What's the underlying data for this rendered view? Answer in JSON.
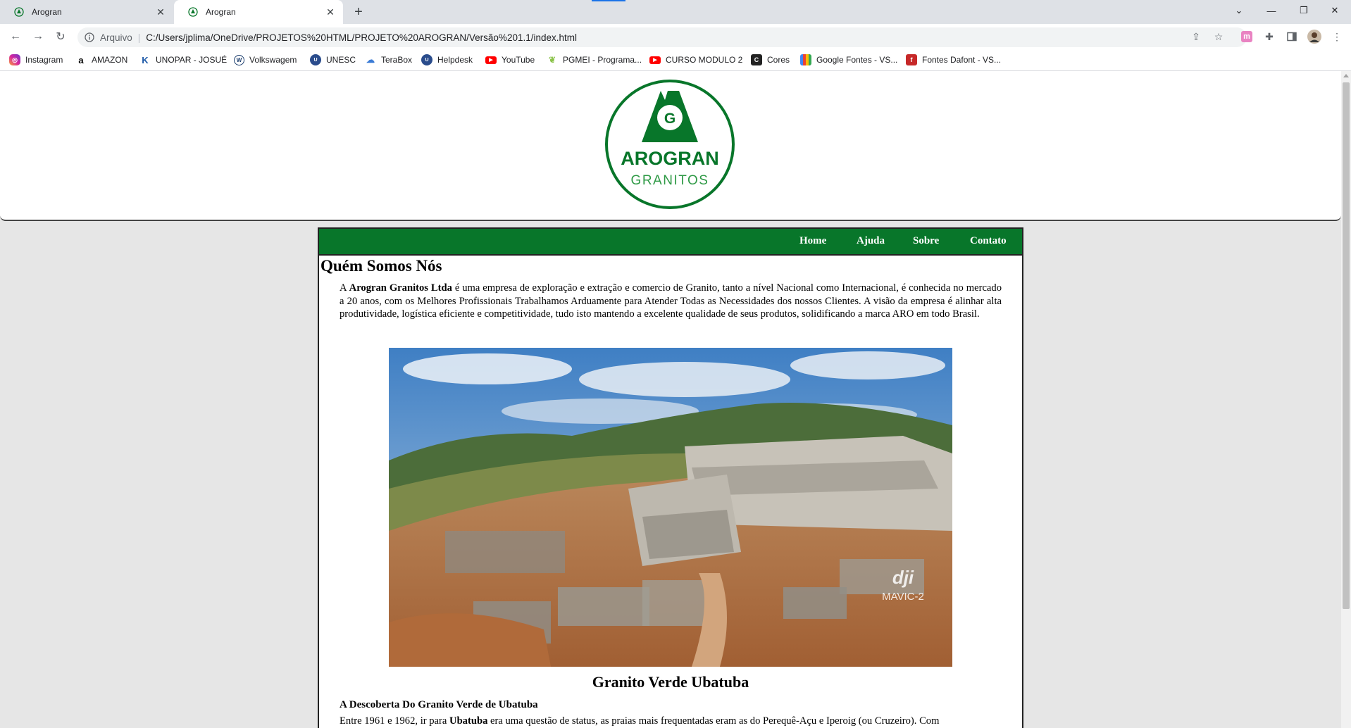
{
  "browser": {
    "tabs": [
      {
        "title": "Arogran",
        "active": false
      },
      {
        "title": "Arogran",
        "active": true
      }
    ],
    "address": {
      "scheme_label": "Arquivo",
      "url": "C:/Users/jplima/OneDrive/PROJETOS%20HTML/PROJETO%20AROGRAN/Versão%201.1/index.html"
    },
    "bookmarks": [
      {
        "label": "Instagram",
        "icon": "instagram-icon",
        "color": "#d6249f"
      },
      {
        "label": "AMAZON",
        "icon": "amazon-icon",
        "color": "#000000"
      },
      {
        "label": "UNOPAR - JOSUÉ",
        "icon": "unopar-icon",
        "color": "#1e5aa8"
      },
      {
        "label": "Volkswagem",
        "icon": "volkswagen-icon",
        "color": "#1b3d6d"
      },
      {
        "label": "UNESC",
        "icon": "unesc-icon",
        "color": "#2a4c8c"
      },
      {
        "label": "TeraBox",
        "icon": "terabox-icon",
        "color": "#3a7bd5"
      },
      {
        "label": "Helpdesk",
        "icon": "helpdesk-icon",
        "color": "#2a4c8c"
      },
      {
        "label": "YouTube",
        "icon": "youtube-icon",
        "color": "#ff0000"
      },
      {
        "label": "PGMEI - Programa...",
        "icon": "pgmei-icon",
        "color": "#8bc34a"
      },
      {
        "label": "CURSO MODULO 2",
        "icon": "youtube-icon",
        "color": "#ff0000"
      },
      {
        "label": "Cores",
        "icon": "cores-icon",
        "color": "#222222"
      },
      {
        "label": "Google Fontes - VS...",
        "icon": "google-fonts-icon",
        "color": "#4285f4"
      },
      {
        "label": "Fontes Dafont - VS...",
        "icon": "dafont-icon",
        "color": "#c62828"
      }
    ]
  },
  "site": {
    "logo": {
      "name": "AROGRAN",
      "tagline": "GRANITOS"
    },
    "menu": [
      "Home",
      "Ajuda",
      "Sobre",
      "Contato"
    ],
    "section_title": "Quém Somos Nós",
    "intro": {
      "prefix": "A ",
      "company": "Arogran Granitos Ltda",
      "text": " é uma empresa de exploração e extração e comercio de Granito, tanto a nível Nacional como Internacional, é conhecida no mercado a 20 anos, com os Melhores Profissionais Trabalhamos Arduamente para Atender Todas as Necessidades dos nossos Clientes. A visão da empresa é alinhar alta produtividade, logística eficiente e competitividade, tudo isto mantendo a excelente qualidade de seus produtos, solidificando a marca ARO em todo Brasil."
    },
    "photo": {
      "watermark_brand": "dji",
      "watermark_model": "MAVIC-2"
    },
    "granite_title": "Granito Verde Ubatuba",
    "discovery_title": "A Descoberta Do Granito Verde de Ubatuba",
    "discovery": {
      "prefix": "Entre 1961 e 1962, ir para ",
      "place": "Ubatuba",
      "text": " era uma questão de status, as praias mais frequentadas eram as do Perequê-Açu e Iperoig (ou Cruzeiro). Com"
    }
  },
  "colors": {
    "brand_green": "#08762a",
    "tab_strip": "#dee1e6"
  }
}
